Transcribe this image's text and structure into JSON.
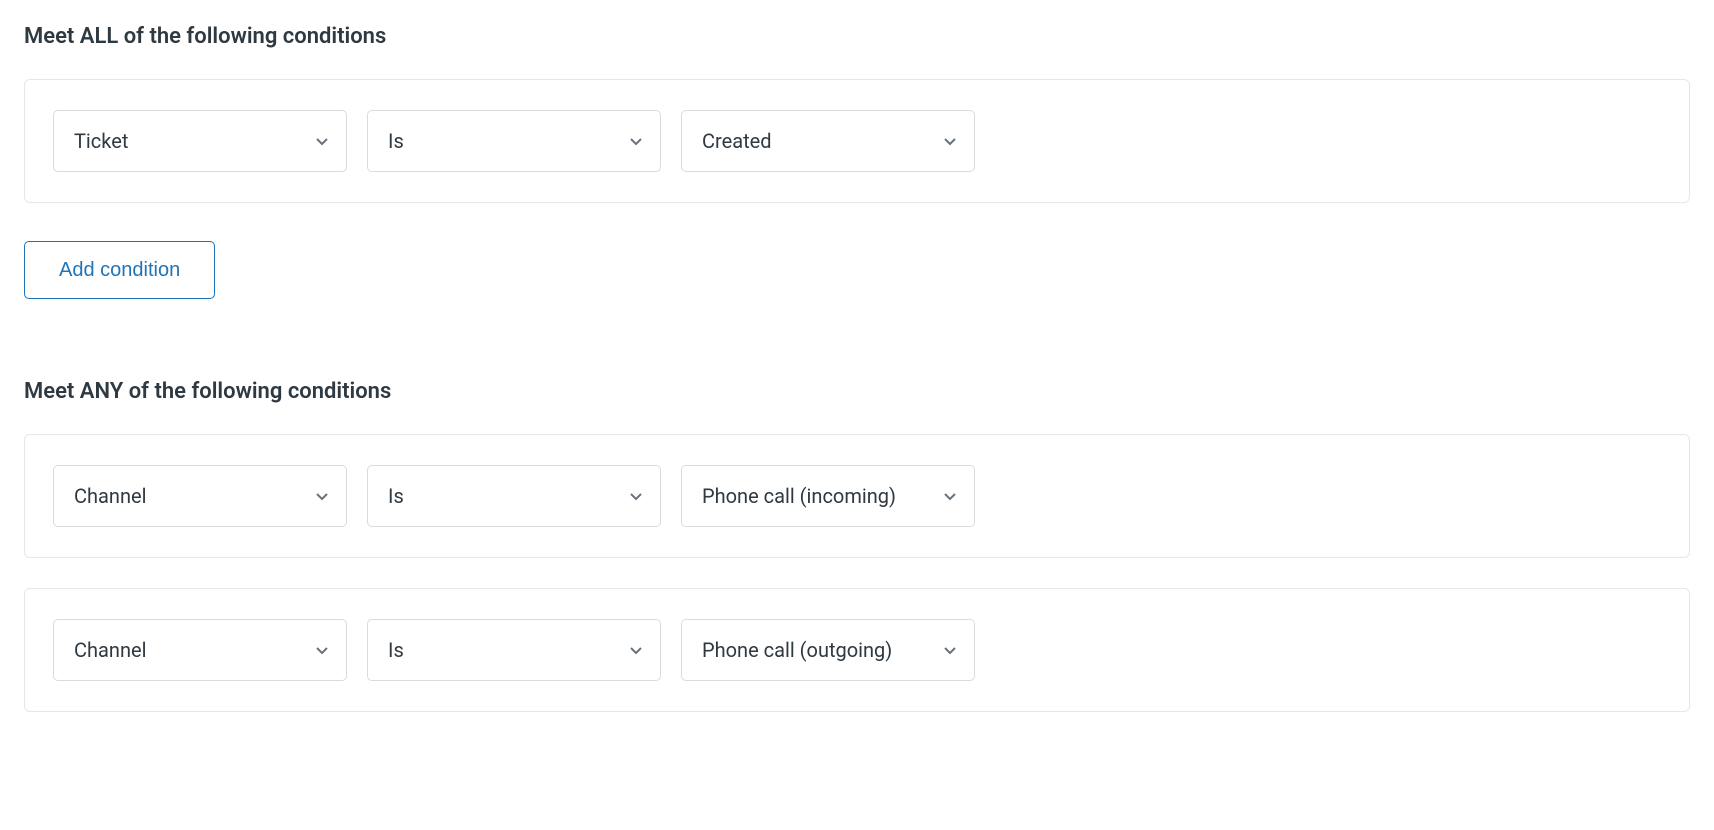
{
  "all_section": {
    "heading": "Meet ALL of the following conditions",
    "rows": [
      {
        "field": "Ticket",
        "operator": "Is",
        "value": "Created"
      }
    ],
    "add_label": "Add condition"
  },
  "any_section": {
    "heading": "Meet ANY of the following conditions",
    "rows": [
      {
        "field": "Channel",
        "operator": "Is",
        "value": "Phone call (incoming)"
      },
      {
        "field": "Channel",
        "operator": "Is",
        "value": "Phone call (outgoing)"
      }
    ]
  }
}
